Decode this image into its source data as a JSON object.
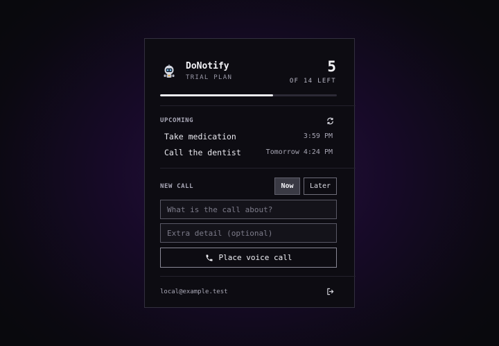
{
  "header": {
    "app_name": "DoNotify",
    "plan": "TRIAL PLAN",
    "remaining": "5",
    "remaining_label": "OF 14 LEFT",
    "progress_fraction": 0.64
  },
  "upcoming": {
    "label": "UPCOMING",
    "refresh_icon": "refresh-icon",
    "items": [
      {
        "title": "Take medication",
        "time": "3:59 PM"
      },
      {
        "title": "Call the dentist",
        "time": "Tomorrow 4:24 PM"
      }
    ]
  },
  "new_call": {
    "label": "NEW CALL",
    "now_label": "Now",
    "later_label": "Later",
    "selected_mode": "Now",
    "topic_placeholder": "What is the call about?",
    "topic_value": "",
    "detail_placeholder": "Extra detail (optional)",
    "detail_value": "",
    "place_call_label": "Place voice call",
    "phone_icon": "phone-icon"
  },
  "footer": {
    "email": "local@example.test",
    "logout_icon": "logout-icon"
  },
  "colors": {
    "panel_bg": "#0d0c12",
    "accent": "#eeeef4",
    "background_glow": "#27113f"
  }
}
